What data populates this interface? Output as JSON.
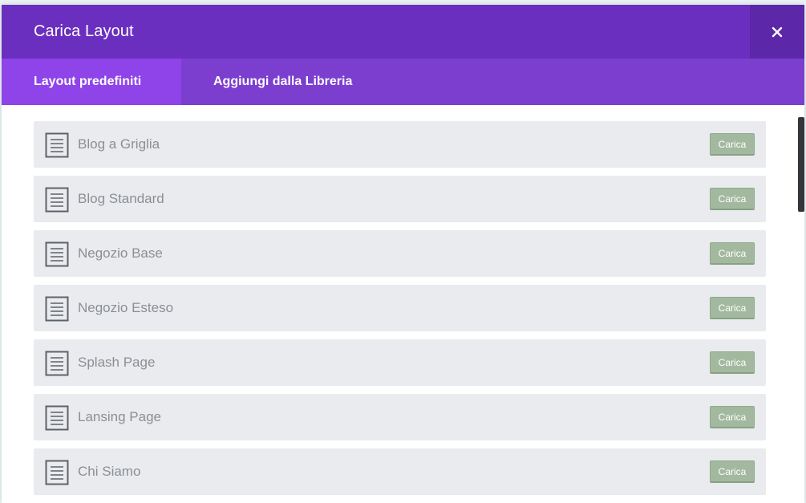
{
  "modal": {
    "title": "Carica Layout",
    "close_icon": "close-icon"
  },
  "tabs": [
    {
      "label": "Layout predefiniti",
      "active": true
    },
    {
      "label": "Aggiungi dalla Libreria",
      "active": false
    }
  ],
  "layouts": [
    {
      "name": "Blog a Griglia",
      "button": "Carica"
    },
    {
      "name": "Blog Standard",
      "button": "Carica"
    },
    {
      "name": "Negozio Base",
      "button": "Carica"
    },
    {
      "name": "Negozio Esteso",
      "button": "Carica"
    },
    {
      "name": "Splash Page",
      "button": "Carica"
    },
    {
      "name": "Lansing Page",
      "button": "Carica"
    },
    {
      "name": "Chi Siamo",
      "button": "Carica"
    }
  ],
  "colors": {
    "header": "#6b2fbf",
    "tab_bar": "#7b3ecf",
    "active_tab": "#8e44e8",
    "row_bg": "#e9ebee",
    "load_button": "#a3b99f"
  }
}
